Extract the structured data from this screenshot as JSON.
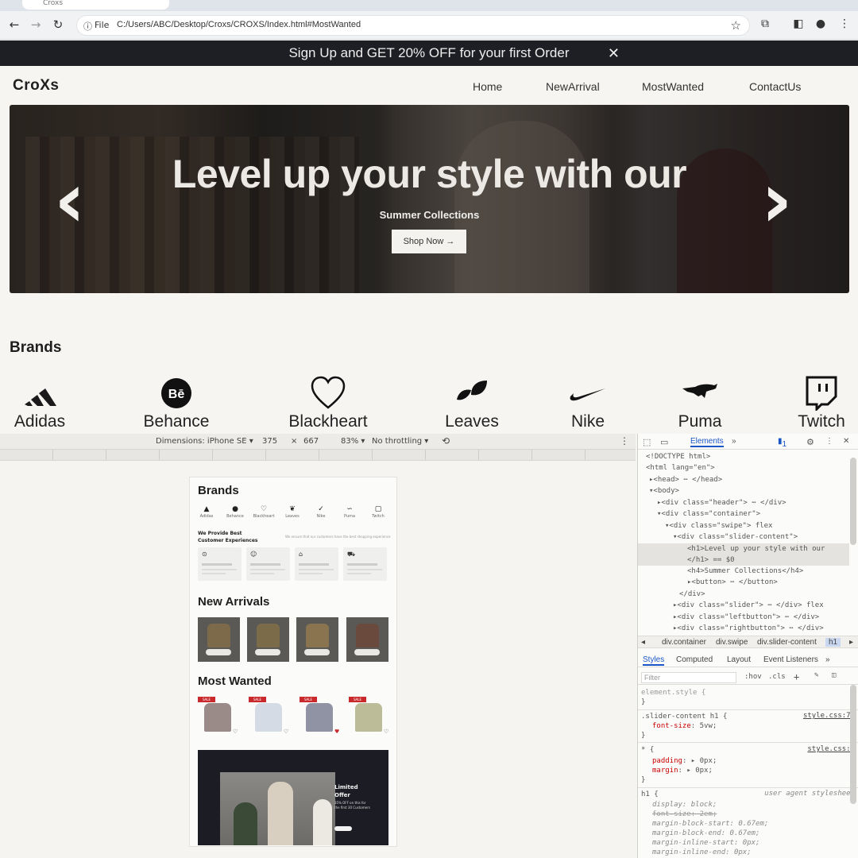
{
  "browser": {
    "tab_title": "Croxs",
    "file_label": "File",
    "url": "C:/Users/ABC/Desktop/Croxs/CROXS/Index.html#MostWanted"
  },
  "site": {
    "promo": "Sign Up and GET 20% OFF for your first Order",
    "logo": "CroXs",
    "nav": [
      "Home",
      "NewArrival",
      "MostWanted",
      "ContactUs"
    ],
    "hero": {
      "title": "Level up your style with our",
      "subtitle": "Summer Collections",
      "button": "Shop Now →"
    },
    "brands_title": "Brands",
    "brands": [
      {
        "label": "Adidas",
        "icon": "adidas-icon"
      },
      {
        "label": "Behance",
        "icon": "behance-icon"
      },
      {
        "label": "Blackheart",
        "icon": "heart-icon"
      },
      {
        "label": "Leaves",
        "icon": "leaves-icon"
      },
      {
        "label": "Nike",
        "icon": "nike-icon"
      },
      {
        "label": "Puma",
        "icon": "puma-icon"
      },
      {
        "label": "Twitch",
        "icon": "twitch-icon"
      }
    ]
  },
  "device_toolbar": {
    "dimensions": "Dimensions: iPhone SE ▾",
    "width": "375",
    "times": "×",
    "height": "667",
    "zoom": "83% ▾",
    "throttle": "No throttling ▾"
  },
  "mobile_preview": {
    "brands_title": "Brands",
    "brands": [
      "Adidas",
      "Behance",
      "Blackheart",
      "Leaves",
      "Nike",
      "Puma",
      "Twitch"
    ],
    "experience_title": "We Provide Best Customer Experiences",
    "experience_note": "We ensure that our customers have the best shopping experience",
    "cards": [
      "Original products",
      "Satisfaction guarantee",
      "New arrival everyday",
      "Fast & free shipping"
    ],
    "new_arrivals_title": "New Arrivals",
    "most_wanted_title": "Most Wanted",
    "sale_tag": "SALE",
    "banner_title": "Limited Offer",
    "banner_text": "35% OFF on this for the first 30 Customers"
  },
  "devtools": {
    "tab_elements": "Elements",
    "issues_count": "1",
    "dom": [
      {
        "indent": 0,
        "text": "<!DOCTYPE html>"
      },
      {
        "indent": 0,
        "text": "<html lang=\"en\">"
      },
      {
        "indent": 1,
        "text": "▸<head> ⋯ </head>"
      },
      {
        "indent": 1,
        "text": "▾<body>"
      },
      {
        "indent": 2,
        "text": "▸<div class=\"header\"> ⋯ </div>"
      },
      {
        "indent": 2,
        "text": "▾<div class=\"container\">"
      },
      {
        "indent": 3,
        "text": "▾<div class=\"swipe\"> flex"
      },
      {
        "indent": 4,
        "text": "▾<div class=\"slider-content\">"
      },
      {
        "indent": 5,
        "text": "<h1>Level up your style with our"
      },
      {
        "indent": 5,
        "text": "</h1> == $0"
      },
      {
        "indent": 5,
        "text": "<h4>Summer Collections</h4>"
      },
      {
        "indent": 5,
        "text": "▸<button> ⋯ </button>"
      },
      {
        "indent": 4,
        "text": "</div>"
      },
      {
        "indent": 4,
        "text": "▸<div class=\"slider\"> ⋯ </div> flex"
      },
      {
        "indent": 4,
        "text": "▸<div class=\"leftbutton\"> ⋯ </div>"
      },
      {
        "indent": 4,
        "text": "▸<div class=\"rightbutton\"> ⋯ </div>"
      }
    ],
    "crumbs": [
      "div.container",
      "div.swipe",
      "div.slider-content",
      "h1"
    ],
    "sub_tabs": [
      "Styles",
      "Computed",
      "Layout",
      "Event Listeners",
      "»"
    ],
    "filter_placeholder": "Filter",
    "hov": ":hov",
    "cls": ".cls",
    "styles": {
      "element_style": "element.style {",
      "rule1_selector": ".slider-content h1 {",
      "rule1_source": "style.css:77",
      "rule1_prop": "font-size",
      "rule1_val": "5vw;",
      "rule2_selector": "* {",
      "rule2_source": "style.css:1",
      "rule2_prop1": "padding",
      "rule2_val1": "▸ 0px;",
      "rule2_prop2": "margin",
      "rule2_val2": "▸ 0px;",
      "rule3_selector": "h1 {",
      "rule3_source": "user agent stylesheet",
      "ua": [
        "display: block;",
        "font-size: 2em;",
        "margin-block-start: 0.67em;",
        "margin-block-end: 0.67em;",
        "margin-inline-start: 0px;",
        "margin-inline-end: 0px;"
      ],
      "close": "}"
    }
  }
}
